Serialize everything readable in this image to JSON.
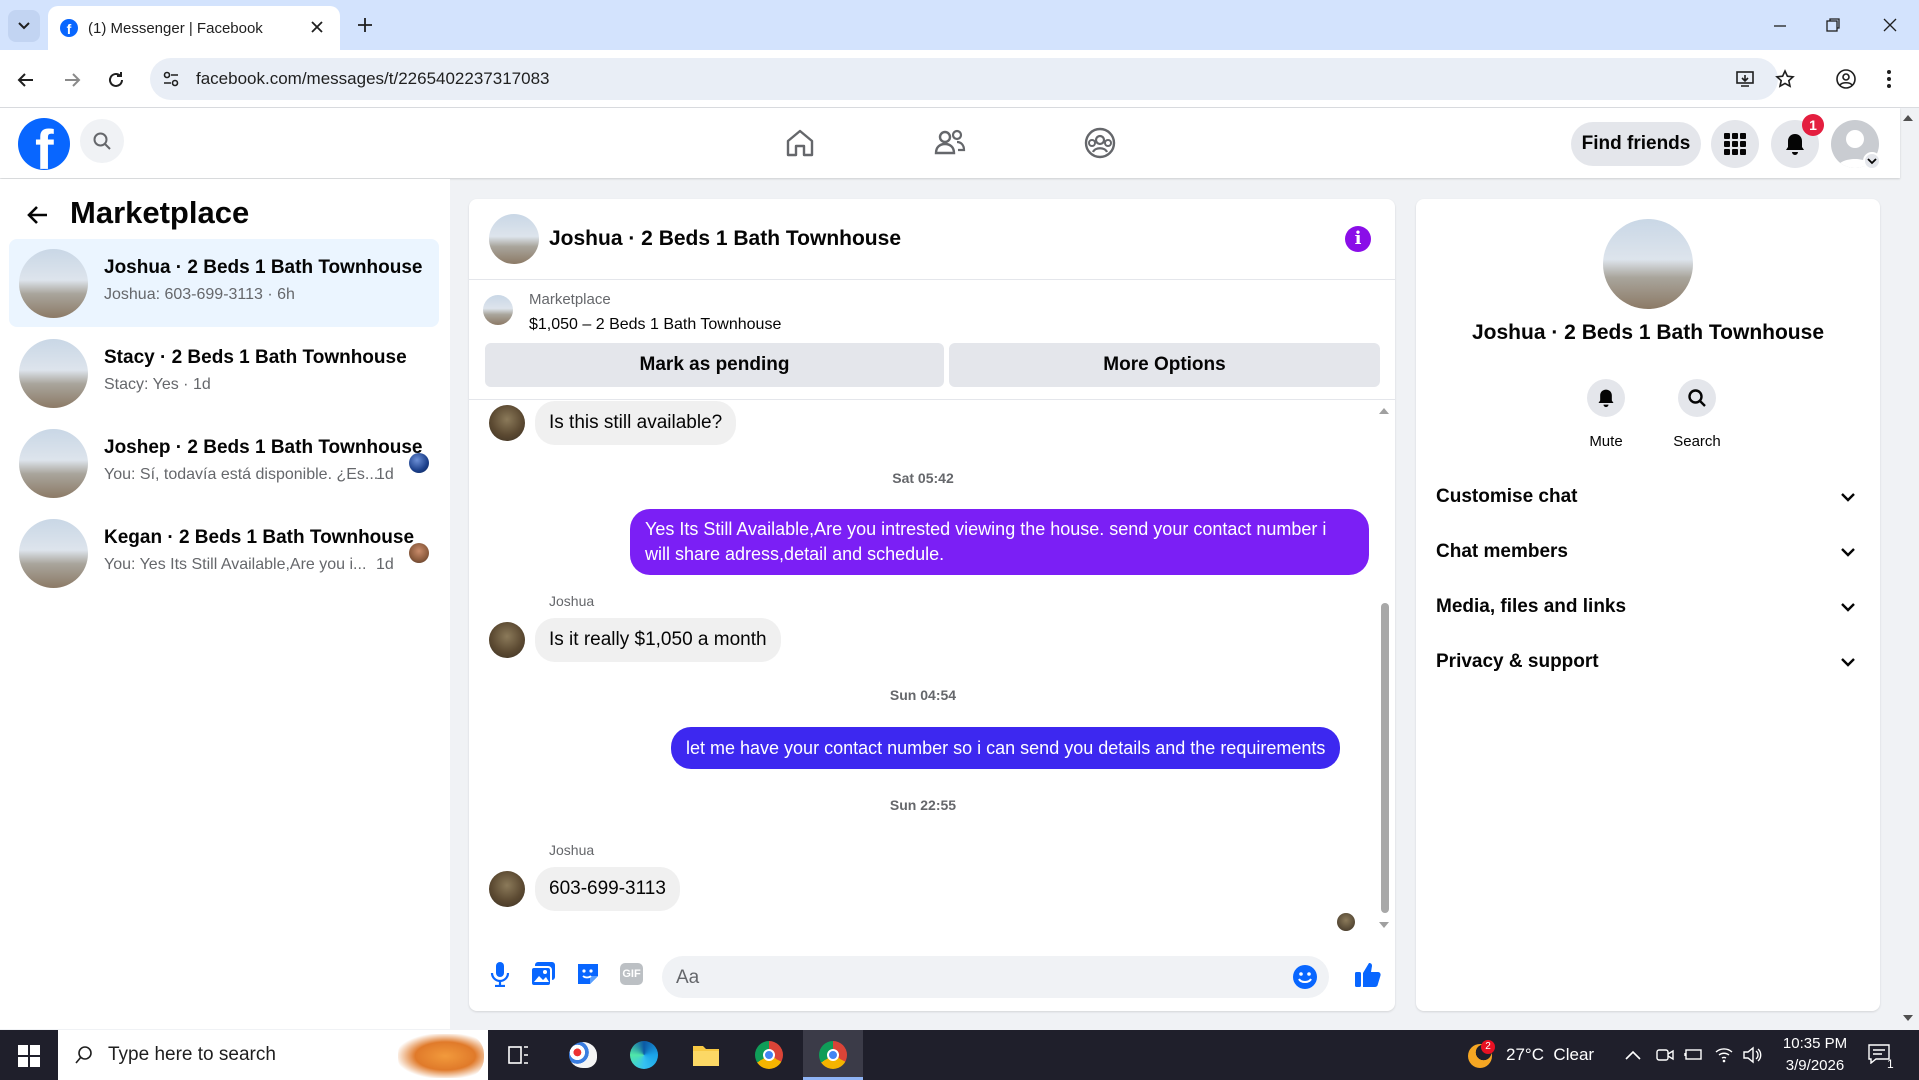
{
  "browser": {
    "tab_title": "(1) Messenger | Facebook",
    "url": "facebook.com/messages/t/2265402237317083"
  },
  "header": {
    "find_friends_label": "Find friends",
    "notification_count": "1"
  },
  "sidebar": {
    "title": "Marketplace",
    "conversations": [
      {
        "title": "Joshua · 2 Beds 1 Bath Townhouse",
        "preview": "Joshua: 603-699-3113 · 6h",
        "time": ""
      },
      {
        "title": "Stacy · 2 Beds 1 Bath Townhouse",
        "preview": "Stacy: Yes · 1d",
        "time": ""
      },
      {
        "title": "Joshep · 2 Beds 1 Bath Townhouse",
        "preview": "You: Sí, todavía está disponible. ¿Es...",
        "time": "1d"
      },
      {
        "title": "Kegan · 2 Beds 1 Bath Townhouse",
        "preview": "You: Yes Its Still Available,Are you i...",
        "time": "1d"
      }
    ]
  },
  "chat": {
    "title": "Joshua · 2 Beds 1 Bath Townhouse",
    "listing_source": "Marketplace",
    "listing_name": "$1,050 – 2 Beds 1 Bath Townhouse",
    "mark_pending_label": "Mark as pending",
    "more_options_label": "More Options",
    "messages": {
      "m1": "Is this still available?",
      "ts1": "Sat 05:42",
      "m2": "Yes Its Still Available,Are you intrested viewing the house. send your contact number i will share adress,detail and schedule.",
      "sender3": "Joshua",
      "m3": "Is it really $1,050 a month",
      "ts2": "Sun 04:54",
      "m4": "let me have your contact number so i can send you details and the requirements",
      "ts3": "Sun 22:55",
      "sender5": "Joshua",
      "m5": "603-699-3113"
    },
    "composer_placeholder": "Aa"
  },
  "info": {
    "name": "Joshua · 2 Beds 1 Bath Townhouse",
    "mute_label": "Mute",
    "search_label": "Search",
    "rows": [
      "Customise chat",
      "Chat members",
      "Media, files and links",
      "Privacy & support"
    ]
  },
  "taskbar": {
    "search_placeholder": "Type here to search",
    "weather": "27°C  Clear",
    "weather_badge": "2",
    "time": "10:35 PM",
    "date": "3/9/2026",
    "notif_count": "1"
  },
  "colors": {
    "fb_blue": "#0866ff",
    "outgoing_bubble": "#7b1ff5",
    "outgoing_bubble_2": "#3d28f0",
    "info_purple": "#8a0ee8"
  }
}
